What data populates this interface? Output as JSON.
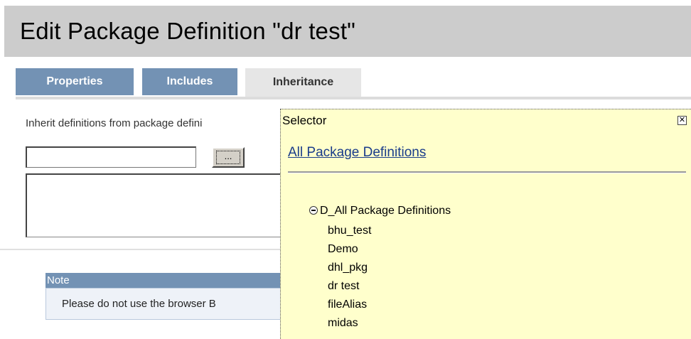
{
  "page": {
    "title": "Edit Package Definition \"dr test\""
  },
  "tabs": [
    {
      "label": "Properties",
      "active": false
    },
    {
      "label": "Includes",
      "active": false
    },
    {
      "label": "Inheritance",
      "active": true
    }
  ],
  "inheritance": {
    "label": "Inherit definitions from package defini",
    "input_value": "",
    "browse_button_label": "...",
    "list_items": []
  },
  "note": {
    "header": "Note",
    "body": "Please do not use the browser B"
  },
  "selector": {
    "title": "Selector",
    "close_icon": "close-icon",
    "link_label": "All Package Definitions",
    "tree": {
      "root_label": "D_All Package Definitions",
      "expanded": true,
      "children": [
        "bhu_test",
        "Demo",
        "dhl_pkg",
        "dr test",
        "fileAlias",
        "midas"
      ]
    }
  },
  "colors": {
    "title_bar": "#cccccc",
    "tab_inactive": "#7392b4",
    "tab_active": "#e6e6e6",
    "selector_bg": "#ffffcc",
    "link": "#1a3c8a"
  }
}
